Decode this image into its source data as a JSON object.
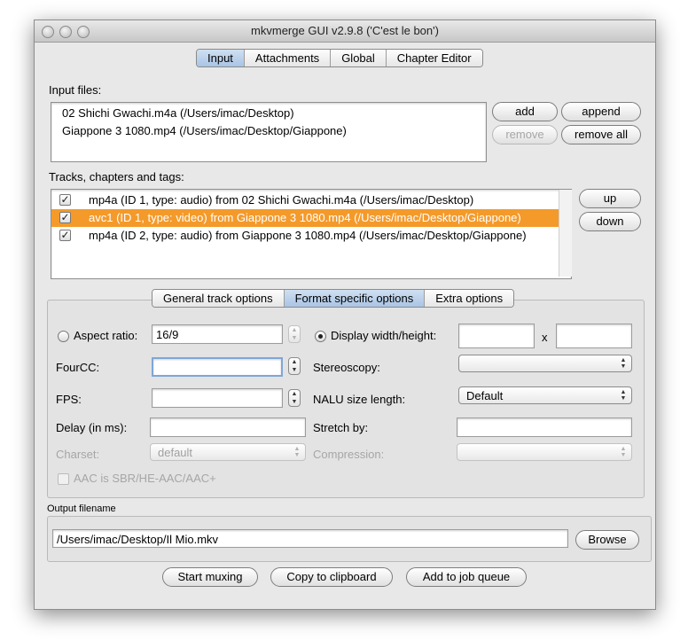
{
  "window": {
    "title": "mkvmerge GUI v2.9.8 ('C'est le bon')"
  },
  "main_tabs": [
    "Input",
    "Attachments",
    "Global",
    "Chapter Editor"
  ],
  "input_files": {
    "label": "Input files:",
    "items": [
      "02 Shichi Gwachi.m4a (/Users/imac/Desktop)",
      "Giappone 3 1080.mp4 (/Users/imac/Desktop/Giappone)"
    ],
    "buttons": {
      "add": "add",
      "append": "append",
      "remove": "remove",
      "remove_all": "remove all"
    }
  },
  "tracks": {
    "label": "Tracks, chapters and tags:",
    "items": [
      "mp4a (ID 1, type: audio) from 02 Shichi Gwachi.m4a (/Users/imac/Desktop)",
      "avc1 (ID 1, type: video) from Giappone 3 1080.mp4 (/Users/imac/Desktop/Giappone)",
      "mp4a (ID 2, type: audio) from Giappone 3 1080.mp4 (/Users/imac/Desktop/Giappone)"
    ],
    "buttons": {
      "up": "up",
      "down": "down"
    }
  },
  "track_tabs": [
    "General track options",
    "Format specific options",
    "Extra options"
  ],
  "format": {
    "aspect_ratio_label": "Aspect ratio:",
    "aspect_ratio_value": "16/9",
    "display_wh_label": "Display width/height:",
    "x_label": "x",
    "fourcc_label": "FourCC:",
    "stereoscopy_label": "Stereoscopy:",
    "fps_label": "FPS:",
    "nalu_label": "NALU size length:",
    "nalu_value": "Default",
    "delay_label": "Delay (in ms):",
    "stretch_label": "Stretch by:",
    "charset_label": "Charset:",
    "charset_value": "default",
    "compression_label": "Compression:",
    "aac_label": "AAC is SBR/HE-AAC/AAC+"
  },
  "output": {
    "label": "Output filename",
    "value": "/Users/imac/Desktop/Il Mio.mkv",
    "browse": "Browse"
  },
  "actions": {
    "start": "Start muxing",
    "copy": "Copy to clipboard",
    "queue": "Add to job queue"
  },
  "colors": {
    "selection": "#f49a2a",
    "tab_selected": "#bcd2ec"
  }
}
